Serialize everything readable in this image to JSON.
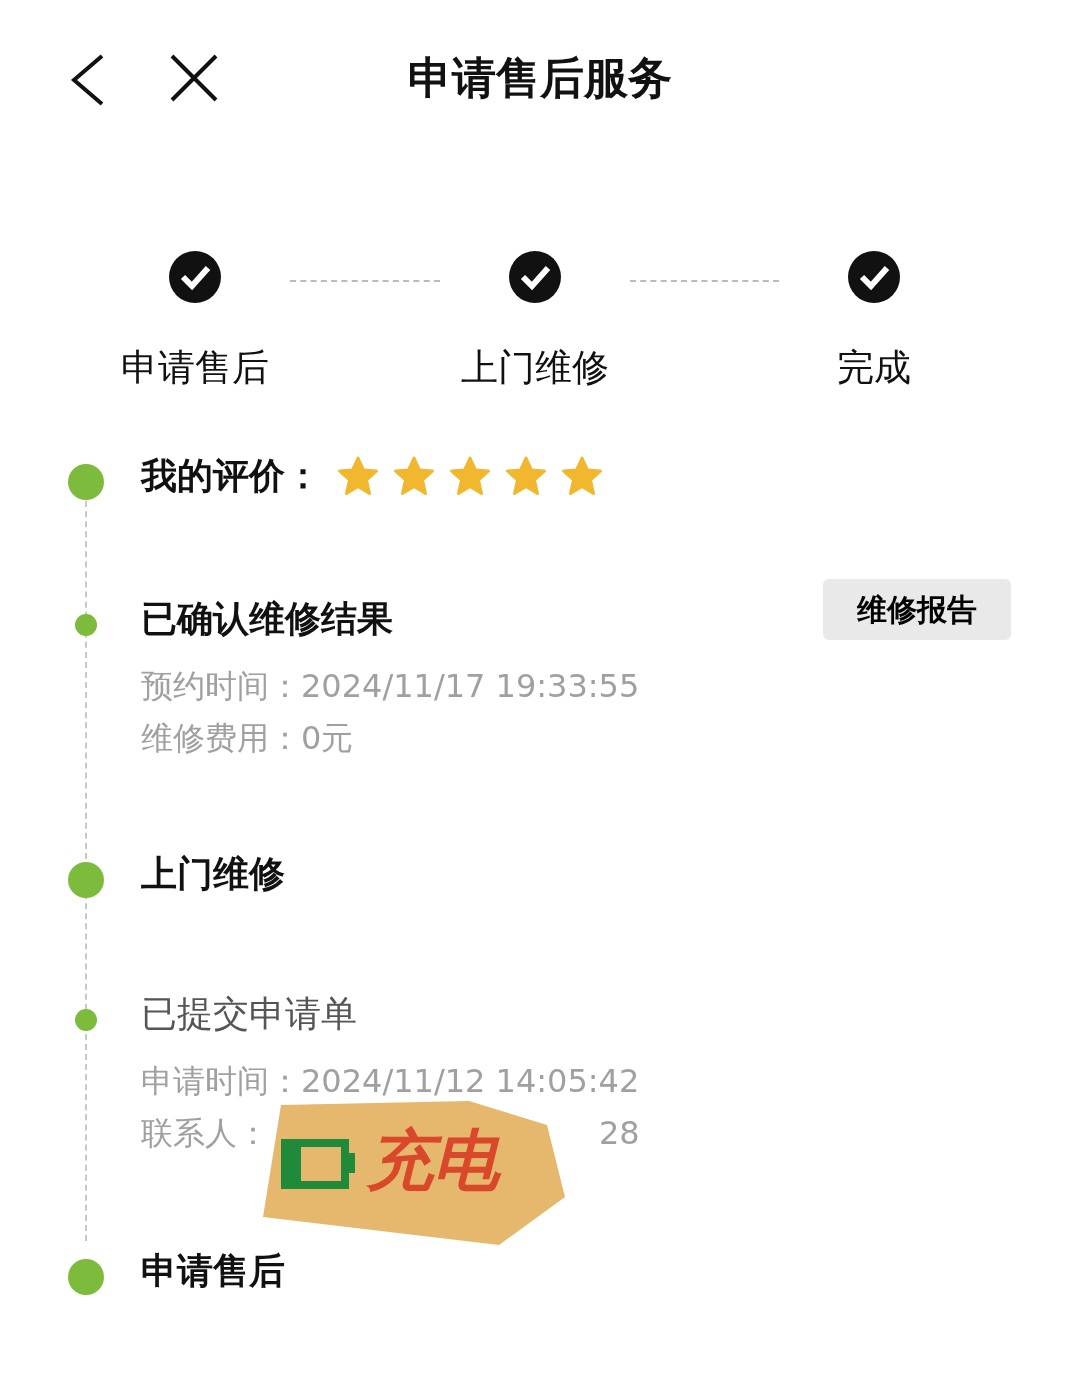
{
  "header": {
    "title": "申请售后服务"
  },
  "steps": [
    {
      "label": "申请售后",
      "done": true
    },
    {
      "label": "上门维修",
      "done": true
    },
    {
      "label": "完成",
      "done": true
    }
  ],
  "timeline": [
    {
      "kind": "major",
      "title": "我的评价：",
      "bold": true,
      "stars": 5
    },
    {
      "kind": "minor",
      "title": "已确认维修结果",
      "bold": true,
      "button": "维修报告",
      "lines": [
        "预约时间：2024/11/17 19:33:55",
        "维修费用：0元"
      ]
    },
    {
      "kind": "major",
      "title": "上门维修",
      "bold": true
    },
    {
      "kind": "minor",
      "title": "已提交申请单",
      "bold": false,
      "lines": [
        "申请时间：2024/11/12 14:05:42"
      ],
      "contact": {
        "label": "联系人：",
        "value": "28"
      },
      "sticker": {
        "text": "充电"
      }
    },
    {
      "kind": "major",
      "title": "申请售后",
      "bold": true
    }
  ]
}
